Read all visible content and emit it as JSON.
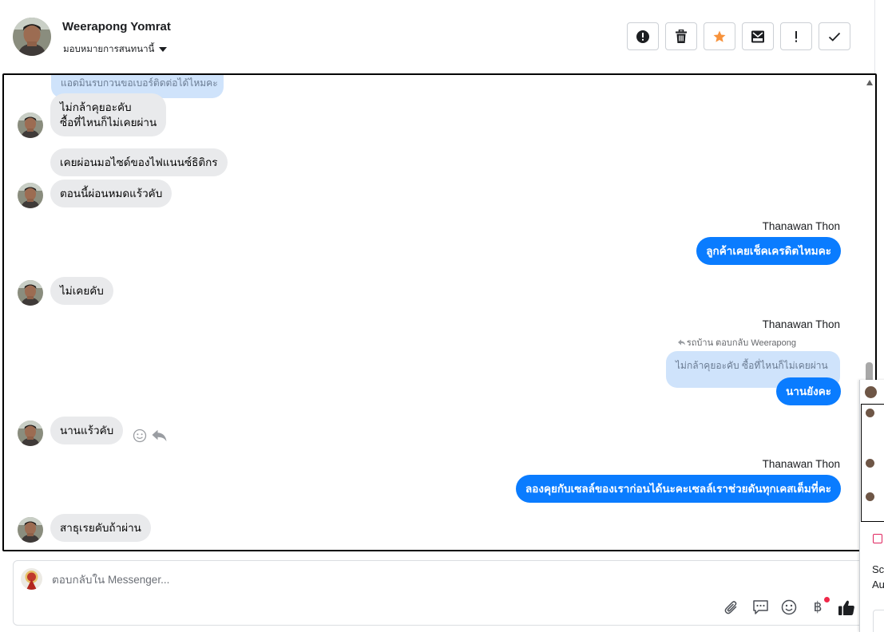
{
  "header": {
    "contact_name": "Weerapong Yomrat",
    "assign_label": "มอบหมายการสนทนานี้",
    "actions": [
      "report-icon",
      "trash-icon",
      "star-icon",
      "mark-unread-icon",
      "important-icon",
      "done-icon"
    ]
  },
  "messages": {
    "quote_top": "แอดมินรบกวนขอเบอร์ติดต่อได้ไหมคะ",
    "in_1": "ไม่กล้าคุยอะคับ\nซื้อที่ไหนก็ไม่เคยผ่าน",
    "in_2": "เคยผ่อนมอไซด์ของไฟแนนซ์ธิติกร",
    "in_3": "ตอนนี้ผ่อนหมดแร้วคับ",
    "sender_1": "Thanawan Thon",
    "out_1": "ลูกค้าเคยเช็คเครดิตไหมคะ",
    "in_4": "ไม่เคยคับ",
    "sender_2": "Thanawan Thon",
    "reply_meta": "รถบ้าน ตอบกลับ Weerapong",
    "quote_reply": "ไม่กล้าคุยอะคับ ซื้อที่ไหนก็ไม่เคยผ่าน",
    "out_2": "นานยังคะ",
    "in_5": "นานแร้วคับ",
    "sender_3": "Thanawan Thon",
    "out_3": "ลองคุยกับเซลล์ของเราก่อนได้นะคะเซลล์เราช่วยดันทุกเคสเต็มที่คะ",
    "in_6": "สาธุเรยคับถ้าผ่าน"
  },
  "composer": {
    "placeholder": "ตอบกลับใน Messenger...",
    "tools": [
      "attach-icon",
      "saved-reply-icon",
      "emoji-icon",
      "payment-icon",
      "like-icon"
    ],
    "payment_symbol": "฿"
  },
  "edge_widget": {
    "text_1": "Sc",
    "text_2": "Au"
  },
  "colors": {
    "outgoing_bubble": "#0a7cff",
    "incoming_bubble": "#e9eaec",
    "quote_bubble": "#cfe3fb",
    "star": "#f7923b",
    "notification_dot": "#f02849"
  }
}
